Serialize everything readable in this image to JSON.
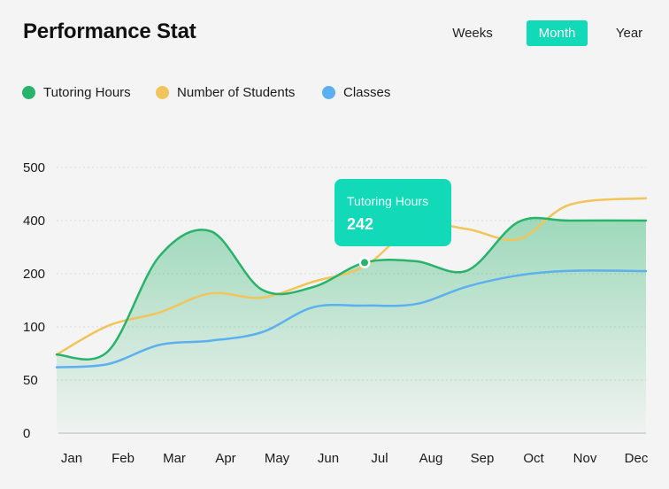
{
  "header": {
    "title": "Performance Stat"
  },
  "tabs": [
    {
      "label": "Weeks",
      "active": false
    },
    {
      "label": "Month",
      "active": true
    },
    {
      "label": "Year",
      "active": false
    }
  ],
  "colors": {
    "accent": "#12d9b7",
    "tutoring": "#27b36a",
    "students": "#f2c45c",
    "classes": "#5cb0ef"
  },
  "tooltip": {
    "series": "Tutoring Hours",
    "value": "242",
    "category": "Jul"
  },
  "chart_data": {
    "type": "line",
    "title": "",
    "xlabel": "",
    "ylabel": "",
    "categories": [
      "Jan",
      "Feb",
      "Mar",
      "Apr",
      "May",
      "Jun",
      "Jul",
      "Aug",
      "Sep",
      "Oct",
      "Nov",
      "Dec"
    ],
    "y_ticks": [
      "0",
      "50",
      "100",
      "200",
      "400",
      "500"
    ],
    "grid": true,
    "legend_position": "top-left",
    "series": [
      {
        "name": "Tutoring Hours",
        "color": "#27b36a",
        "fill": true,
        "values": [
          74,
          77,
          265,
          360,
          170,
          175,
          242,
          247,
          212,
          395,
          400,
          400
        ]
      },
      {
        "name": "Number of Students",
        "color": "#f2c45c",
        "fill": false,
        "values": [
          74,
          102,
          127,
          163,
          155,
          185,
          228,
          380,
          368,
          330,
          430,
          442
        ]
      },
      {
        "name": "Classes",
        "color": "#5cb0ef",
        "fill": false,
        "values": [
          62,
          65,
          83,
          87,
          95,
          137,
          140,
          143,
          176,
          197,
          211,
          210
        ]
      }
    ]
  }
}
